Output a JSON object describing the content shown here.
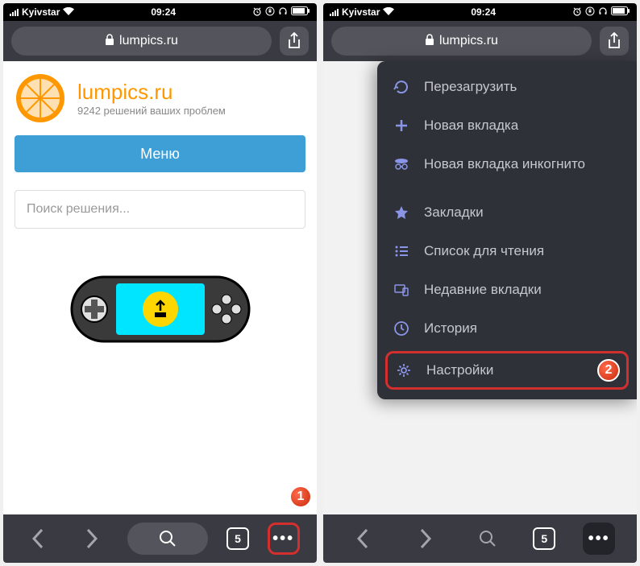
{
  "status": {
    "carrier": "Kyivstar",
    "time": "09:24",
    "icons": {
      "alarm": "⏰",
      "rotation": "🔒",
      "headphones": "🎧"
    }
  },
  "urlbar": {
    "domain": "lumpics.ru"
  },
  "site": {
    "name": "lumpics.ru",
    "tagline": "9242 решений ваших проблем",
    "menu_label": "Меню",
    "search_placeholder": "Поиск решения..."
  },
  "bottom": {
    "tab_count": "5",
    "more": "•••"
  },
  "callouts": {
    "one": "1",
    "two": "2"
  },
  "popup": {
    "reload": "Перезагрузить",
    "new_tab": "Новая вкладка",
    "incognito": "Новая вкладка инкогнито",
    "bookmarks": "Закладки",
    "reading_list": "Список для чтения",
    "recent_tabs": "Недавние вкладки",
    "history": "История",
    "settings": "Настройки"
  }
}
